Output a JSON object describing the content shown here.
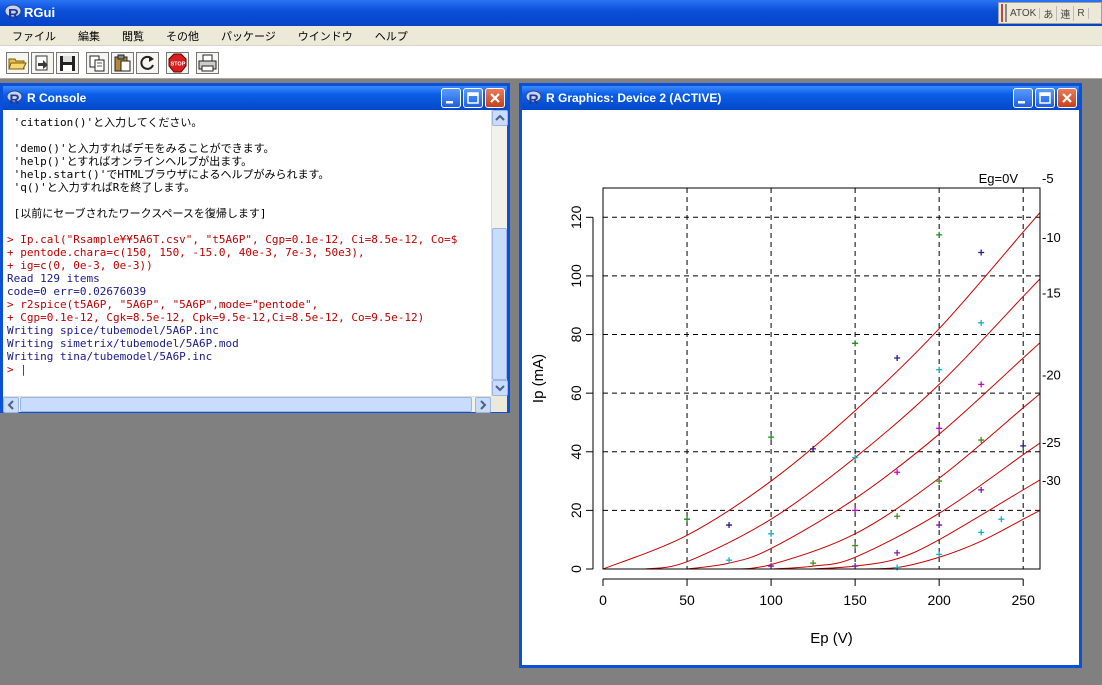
{
  "app": {
    "title": "RGui",
    "ime": [
      "ATOK",
      "あ",
      "連",
      "R"
    ]
  },
  "menu": [
    "ファイル",
    "編集",
    "閲覧",
    "その他",
    "パッケージ",
    "ウインドウ",
    "ヘルプ"
  ],
  "toolbar": [
    {
      "name": "open-script-button",
      "icon": "open-folder-icon"
    },
    {
      "name": "load-workspace-button",
      "icon": "load-icon"
    },
    {
      "name": "save-workspace-button",
      "icon": "floppy-icon"
    },
    {
      "name": "copy-button",
      "icon": "copy-icon"
    },
    {
      "name": "paste-button",
      "icon": "paste-icon"
    },
    {
      "name": "copy-paste-button",
      "icon": "refresh-icon"
    },
    {
      "name": "stop-button",
      "icon": "stop-icon"
    },
    {
      "name": "print-button",
      "icon": "printer-icon"
    }
  ],
  "console": {
    "title": "R Console",
    "lines": [
      {
        "text": " 'citation()'と入力してください。",
        "style": "black"
      },
      {
        "text": "",
        "style": "black"
      },
      {
        "text": " 'demo()'と入力すればデモをみることができます。",
        "style": "black"
      },
      {
        "text": " 'help()'とすればオンラインヘルプが出ます。",
        "style": "black"
      },
      {
        "text": " 'help.start()'でHTMLブラウザによるヘルプがみられます。",
        "style": "black"
      },
      {
        "text": " 'q()'と入力すればRを終了します。",
        "style": "black"
      },
      {
        "text": "",
        "style": "black"
      },
      {
        "text": " [以前にセーブされたワークスペースを復帰します]",
        "style": "black"
      },
      {
        "text": "",
        "style": "black"
      },
      {
        "text": "> Ip.cal(\"Rsample¥¥5A6T.csv\", \"t5A6P\", Cgp=0.1e-12, Ci=8.5e-12, Co=$",
        "style": "red"
      },
      {
        "text": "+ pentode.chara=c(150, 150, -15.0, 40e-3, 7e-3, 50e3),",
        "style": "red"
      },
      {
        "text": "+ ig=c(0, 0e-3, 0e-3))",
        "style": "red"
      },
      {
        "text": "Read 129 items",
        "style": "blue"
      },
      {
        "text": "code=0 err=0.02676039",
        "style": "blue"
      },
      {
        "text": "> r2spice(t5A6P, \"5A6P\", \"5A6P\",mode=\"pentode\",",
        "style": "red"
      },
      {
        "text": "+ Cgp=0.1e-12, Cgk=8.5e-12, Cpk=9.5e-12,Ci=8.5e-12, Co=9.5e-12)",
        "style": "red"
      },
      {
        "text": "Writing spice/tubemodel/5A6P.inc",
        "style": "blue"
      },
      {
        "text": "Writing simetrix/tubemodel/5A6P.mod",
        "style": "blue"
      },
      {
        "text": "Writing tina/tubemodel/5A6P.inc",
        "style": "blue"
      },
      {
        "text": "> |",
        "style": "red"
      }
    ]
  },
  "graphics": {
    "title": "R Graphics: Device 2 (ACTIVE)"
  },
  "chart_data": {
    "type": "line",
    "title": "",
    "xlabel": "Ep (V)",
    "ylabel": "Ip (mA)",
    "xlim": [
      0,
      260
    ],
    "ylim": [
      0,
      130
    ],
    "xticks": [
      0,
      50,
      100,
      150,
      200,
      250
    ],
    "yticks": [
      0,
      20,
      40,
      60,
      80,
      100,
      120
    ],
    "grid_x": [
      50,
      100,
      150,
      200,
      250
    ],
    "grid_y": [
      20,
      40,
      60,
      80,
      100,
      120
    ],
    "grid": "dashed",
    "curve_color": "#cc0000",
    "series": [
      {
        "name": "Eg=0V",
        "label_y": 133,
        "x": [
          0,
          50,
          100,
          150,
          200,
          250
        ],
        "y": [
          0,
          11.5,
          30,
          54,
          82,
          115
        ]
      },
      {
        "name": "-5",
        "label_y": 133,
        "x": [
          25,
          50,
          100,
          150,
          200,
          250
        ],
        "y": [
          0,
          2.5,
          17,
          38,
          63,
          93
        ]
      },
      {
        "name": "-10",
        "label_y": 113,
        "x": [
          50,
          75,
          100,
          150,
          200,
          250
        ],
        "y": [
          0,
          2,
          7,
          24,
          46,
          72
        ]
      },
      {
        "name": "-15",
        "label_y": 94,
        "x": [
          75,
          100,
          150,
          200,
          250
        ],
        "y": [
          0,
          1.5,
          12,
          31,
          55
        ]
      },
      {
        "name": "-20",
        "label_y": 66,
        "x": [
          100,
          125,
          150,
          200,
          250
        ],
        "y": [
          0,
          1,
          4,
          19,
          39
        ]
      },
      {
        "name": "-25",
        "label_y": 43,
        "x": [
          125,
          150,
          175,
          200,
          250
        ],
        "y": [
          0,
          1,
          3.5,
          10,
          27
        ]
      },
      {
        "name": "-30",
        "label_y": 30,
        "x": [
          150,
          175,
          200,
          225,
          250
        ],
        "y": [
          0,
          0.5,
          4,
          9.5,
          17
        ]
      }
    ],
    "points": [
      {
        "color": "#228b22",
        "x": 50,
        "y": 17
      },
      {
        "color": "#228b22",
        "x": 100,
        "y": 45
      },
      {
        "color": "#228b22",
        "x": 150,
        "y": 77
      },
      {
        "color": "#228b22",
        "x": 200,
        "y": 114
      },
      {
        "color": "#2a1a8c",
        "x": 75,
        "y": 15
      },
      {
        "color": "#2a1a8c",
        "x": 125,
        "y": 41
      },
      {
        "color": "#2a1a8c",
        "x": 175,
        "y": 72
      },
      {
        "color": "#2a1a8c",
        "x": 225,
        "y": 108
      },
      {
        "color": "#1ab0cc",
        "x": 75,
        "y": 3
      },
      {
        "color": "#1ab0cc",
        "x": 100,
        "y": 12
      },
      {
        "color": "#1ab0cc",
        "x": 150,
        "y": 38
      },
      {
        "color": "#1ab0cc",
        "x": 200,
        "y": 68
      },
      {
        "color": "#1ab0cc",
        "x": 225,
        "y": 84
      },
      {
        "color": "#cc00cc",
        "x": 150,
        "y": 20
      },
      {
        "color": "#cc00cc",
        "x": 175,
        "y": 33
      },
      {
        "color": "#cc00cc",
        "x": 200,
        "y": 48
      },
      {
        "color": "#cc00cc",
        "x": 225,
        "y": 63
      },
      {
        "color": "#4a8a1a",
        "x": 125,
        "y": 2
      },
      {
        "color": "#4a8a1a",
        "x": 150,
        "y": 8
      },
      {
        "color": "#4a8a1a",
        "x": 175,
        "y": 18
      },
      {
        "color": "#4a8a1a",
        "x": 200,
        "y": 30
      },
      {
        "color": "#4a8a1a",
        "x": 225,
        "y": 44
      },
      {
        "color": "#7a1a9c",
        "x": 100,
        "y": 1
      },
      {
        "color": "#7a1a9c",
        "x": 150,
        "y": 1
      },
      {
        "color": "#7a1a9c",
        "x": 175,
        "y": 5.5
      },
      {
        "color": "#7a1a9c",
        "x": 200,
        "y": 15
      },
      {
        "color": "#7a1a9c",
        "x": 225,
        "y": 27
      },
      {
        "color": "#2a1a8c",
        "x": 250,
        "y": 42
      },
      {
        "color": "#1ab0cc",
        "x": 175,
        "y": 0.5
      },
      {
        "color": "#1ab0cc",
        "x": 200,
        "y": 5
      },
      {
        "color": "#1ab0cc",
        "x": 225,
        "y": 12.5
      },
      {
        "color": "#1ab0cc",
        "x": 237,
        "y": 17
      }
    ]
  }
}
